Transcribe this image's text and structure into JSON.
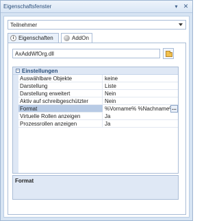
{
  "window": {
    "title": "Eigenschaftsfenster",
    "pin_glyph": "▾",
    "close_glyph": "✕"
  },
  "selector": {
    "value": "Teilnehmer"
  },
  "tabs": [
    {
      "label": "Eigenschaften",
      "icon": "info-icon",
      "active": false
    },
    {
      "label": "AddOn",
      "icon": "addon-icon",
      "active": true
    }
  ],
  "addon": {
    "dll_path": "AxAddWfOrg.dll",
    "browse_icon": "folder-open-icon"
  },
  "property_grid": {
    "category": "Einstellungen",
    "rows": [
      {
        "name": "Auswählbare Objekte",
        "value": "keine"
      },
      {
        "name": "Darstellung",
        "value": "Liste"
      },
      {
        "name": "Darstellung erweitert",
        "value": "Nein"
      },
      {
        "name": "Aktiv auf schreibgeschützter",
        "value": "Nein"
      },
      {
        "name": "Format",
        "value": "%Vorname% %Nachname%",
        "selected": true
      },
      {
        "name": "Virtuelle Rollen anzeigen",
        "value": "Ja"
      },
      {
        "name": "Prozessrollen anzeigen",
        "value": "Ja"
      }
    ],
    "ellipsis_label": "..."
  },
  "help": {
    "title": "Format"
  },
  "colors": {
    "accent": "#2b4f7a",
    "selection": "#b8cbe5",
    "frame": "#d7e4f3"
  }
}
